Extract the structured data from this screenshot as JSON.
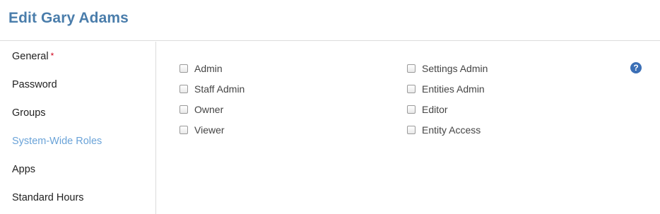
{
  "header": {
    "title": "Edit Gary Adams"
  },
  "sidebar": {
    "items": [
      {
        "label": "General",
        "required_marker": "*"
      },
      {
        "label": "Password"
      },
      {
        "label": "Groups"
      },
      {
        "label": "System-Wide Roles",
        "active": true
      },
      {
        "label": "Apps"
      },
      {
        "label": "Standard Hours"
      }
    ]
  },
  "roles": {
    "left": [
      {
        "label": "Admin",
        "checked": false
      },
      {
        "label": "Staff Admin",
        "checked": false
      },
      {
        "label": "Owner",
        "checked": false
      },
      {
        "label": "Viewer",
        "checked": false
      }
    ],
    "right": [
      {
        "label": "Settings Admin",
        "checked": false
      },
      {
        "label": "Entities Admin",
        "checked": false
      },
      {
        "label": "Editor",
        "checked": false
      },
      {
        "label": "Entity Access",
        "checked": false
      }
    ]
  },
  "help": {
    "icon": "question-circle-icon",
    "glyph": "?"
  },
  "colors": {
    "title": "#4a7dab",
    "active_nav": "#6aa3d8",
    "required": "#d0021b",
    "help_icon": "#3b6fb6"
  }
}
